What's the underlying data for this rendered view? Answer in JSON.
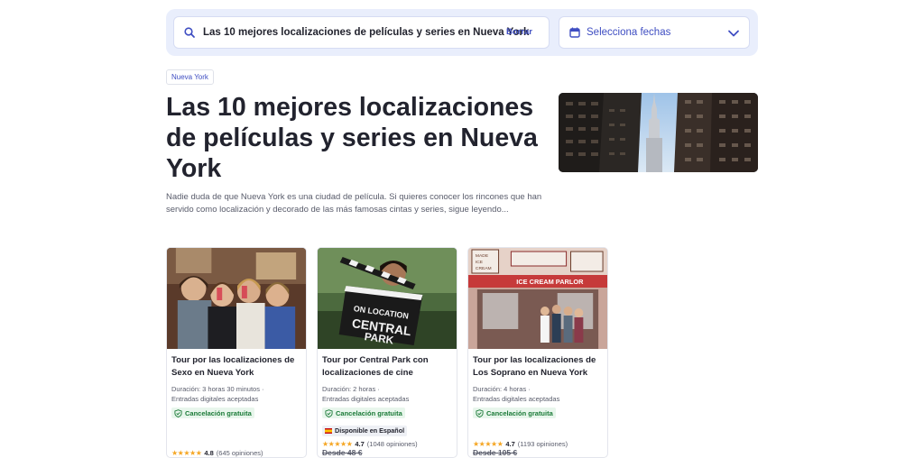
{
  "search": {
    "query": "Las 10 mejores localizaciones de películas y series en Nueva York",
    "clear_label": "Borrar",
    "date_placeholder": "Selecciona fechas"
  },
  "breadcrumb": {
    "tag": "Nueva York"
  },
  "article": {
    "title": "Las 10 mejores localizaciones de películas y series en Nueva York",
    "description": "Nadie duda de que Nueva York es una ciudad de película. Si quieres conocer los rincones que han servido como localización y decorado de las más famosas cintas y series, sigue leyendo..."
  },
  "colors": {
    "accent": "#3f4ec2",
    "success": "#1a7a37",
    "star": "#f5a623"
  },
  "cards": [
    {
      "title": "Tour por las localizaciones de Sexo en Nueva York",
      "duration": "Duración: 3 horas 30 minutos ·",
      "tickets": "Entradas digitales aceptadas",
      "badge": "Cancelación gratuita",
      "rating": "4.8",
      "reviews": "(645 opiniones)"
    },
    {
      "title": "Tour por Central Park con localizaciones de cine",
      "duration": "Duración: 2 horas ·",
      "tickets": "Entradas digitales aceptadas",
      "badge": "Cancelación gratuita",
      "language": "Disponible en Español",
      "rating": "4.7",
      "reviews": "(1048 opiniones)",
      "price": "Desde 48 €"
    },
    {
      "title": "Tour por las localizaciones de Los Soprano en Nueva York",
      "duration": "Duración: 4 horas ·",
      "tickets": "Entradas digitales aceptadas",
      "badge": "Cancelación gratuita",
      "rating": "4.7",
      "reviews": "(1193 opiniones)",
      "price": "Desde 105 €"
    }
  ]
}
